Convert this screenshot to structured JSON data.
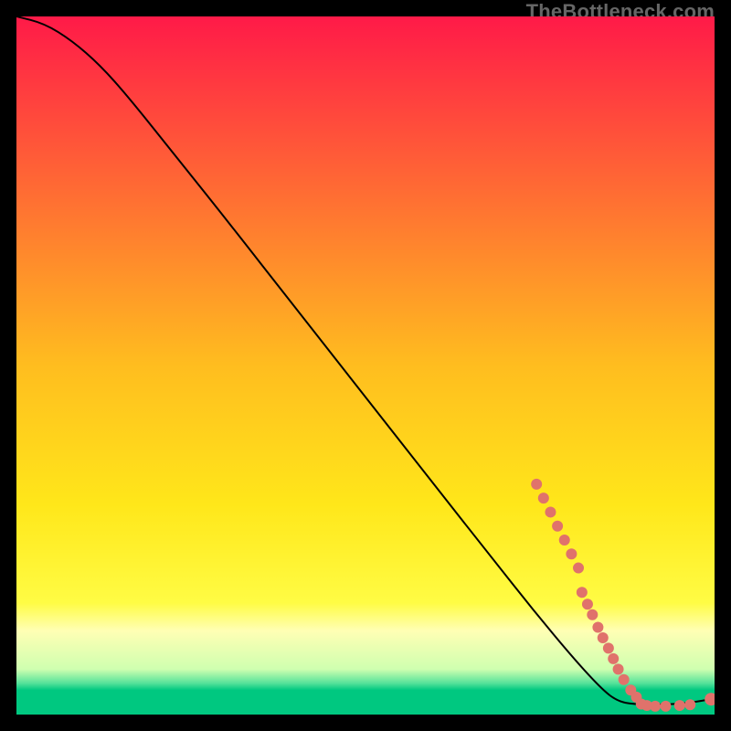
{
  "watermark": "TheBottleneck.com",
  "chart_data": {
    "type": "line",
    "title": "",
    "xlabel": "",
    "ylabel": "",
    "xlim": [
      0,
      100
    ],
    "ylim": [
      0,
      100
    ],
    "background_gradient": [
      {
        "stop": 0.0,
        "color": "#ff1a48"
      },
      {
        "stop": 0.5,
        "color": "#ffbd1f"
      },
      {
        "stop": 0.7,
        "color": "#ffe71a"
      },
      {
        "stop": 0.84,
        "color": "#fffc44"
      },
      {
        "stop": 0.88,
        "color": "#ffffb4"
      },
      {
        "stop": 0.935,
        "color": "#cfffb0"
      },
      {
        "stop": 0.955,
        "color": "#56e29a"
      },
      {
        "stop": 0.965,
        "color": "#00c880"
      },
      {
        "stop": 1.0,
        "color": "#00c880"
      }
    ],
    "series": [
      {
        "name": "curve",
        "stroke": "#000000",
        "points": [
          {
            "x": 0.0,
            "y": 100.0
          },
          {
            "x": 4.0,
            "y": 99.0
          },
          {
            "x": 8.0,
            "y": 96.5
          },
          {
            "x": 12.0,
            "y": 93.0
          },
          {
            "x": 16.0,
            "y": 88.5
          },
          {
            "x": 22.0,
            "y": 81.0
          },
          {
            "x": 30.0,
            "y": 71.0
          },
          {
            "x": 40.0,
            "y": 58.2
          },
          {
            "x": 50.0,
            "y": 45.5
          },
          {
            "x": 60.0,
            "y": 32.7
          },
          {
            "x": 68.0,
            "y": 22.6
          },
          {
            "x": 74.0,
            "y": 15.0
          },
          {
            "x": 80.0,
            "y": 7.8
          },
          {
            "x": 84.0,
            "y": 3.5
          },
          {
            "x": 86.0,
            "y": 2.0
          },
          {
            "x": 88.0,
            "y": 1.5
          },
          {
            "x": 92.0,
            "y": 1.4
          },
          {
            "x": 96.0,
            "y": 1.6
          },
          {
            "x": 100.0,
            "y": 2.3
          }
        ]
      }
    ],
    "markers": {
      "color": "#e0726b",
      "radius_small": 5,
      "radius_large": 7,
      "points": [
        {
          "x": 74.5,
          "y": 33.0,
          "r": 6
        },
        {
          "x": 75.5,
          "y": 31.0,
          "r": 6
        },
        {
          "x": 76.5,
          "y": 29.0,
          "r": 6
        },
        {
          "x": 77.5,
          "y": 27.0,
          "r": 6
        },
        {
          "x": 78.5,
          "y": 25.0,
          "r": 6
        },
        {
          "x": 79.5,
          "y": 23.0,
          "r": 6
        },
        {
          "x": 80.5,
          "y": 21.0,
          "r": 6
        },
        {
          "x": 81.0,
          "y": 17.5,
          "r": 6
        },
        {
          "x": 81.8,
          "y": 15.8,
          "r": 6
        },
        {
          "x": 82.5,
          "y": 14.3,
          "r": 6
        },
        {
          "x": 83.3,
          "y": 12.5,
          "r": 6
        },
        {
          "x": 84.0,
          "y": 11.0,
          "r": 6
        },
        {
          "x": 84.8,
          "y": 9.5,
          "r": 6
        },
        {
          "x": 85.5,
          "y": 8.0,
          "r": 6
        },
        {
          "x": 86.2,
          "y": 6.5,
          "r": 6
        },
        {
          "x": 87.0,
          "y": 5.0,
          "r": 6
        },
        {
          "x": 88.0,
          "y": 3.5,
          "r": 6
        },
        {
          "x": 88.8,
          "y": 2.5,
          "r": 6
        },
        {
          "x": 89.5,
          "y": 1.5,
          "r": 6
        },
        {
          "x": 90.3,
          "y": 1.3,
          "r": 6
        },
        {
          "x": 91.5,
          "y": 1.2,
          "r": 6
        },
        {
          "x": 93.0,
          "y": 1.2,
          "r": 6
        },
        {
          "x": 95.0,
          "y": 1.3,
          "r": 6
        },
        {
          "x": 96.5,
          "y": 1.4,
          "r": 6
        },
        {
          "x": 99.5,
          "y": 2.2,
          "r": 7
        }
      ]
    }
  }
}
